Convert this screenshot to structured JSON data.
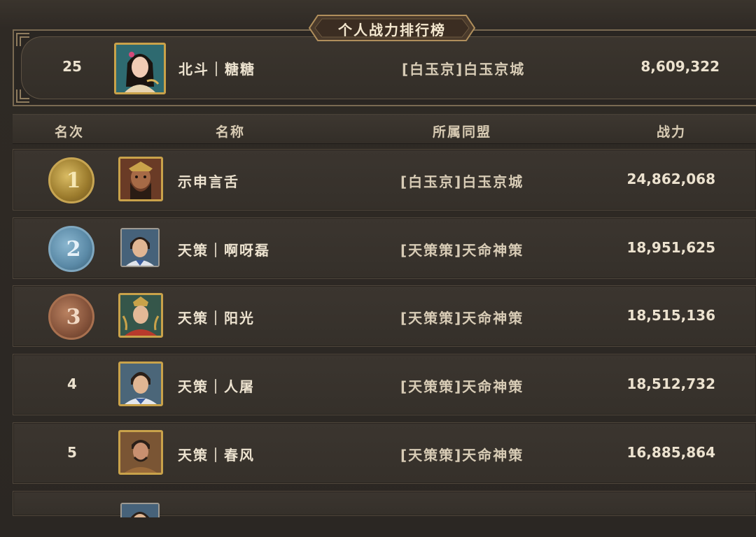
{
  "title": "个人战力排行榜",
  "my_rank": {
    "rank": "25",
    "name": "北斗｜糖糖",
    "alliance": "[白玉京]白玉京城",
    "power": "8,609,322",
    "avatar_icon": "female-hero-portrait"
  },
  "columns": {
    "rank": "名次",
    "name": "名称",
    "alliance": "所属同盟",
    "power": "战力"
  },
  "rows": [
    {
      "rank": "1",
      "name": "示申言舌",
      "alliance": "[白玉京]白玉京城",
      "power": "24,862,068",
      "medal": "gold"
    },
    {
      "rank": "2",
      "name": "天策｜啊呀磊",
      "alliance": "[天策策]天命神策",
      "power": "18,951,625",
      "medal": "silver"
    },
    {
      "rank": "3",
      "name": "天策｜阳光",
      "alliance": "[天策策]天命神策",
      "power": "18,515,136",
      "medal": "bronze"
    },
    {
      "rank": "4",
      "name": "天策｜人屠",
      "alliance": "[天策策]天命神策",
      "power": "18,512,732",
      "medal": ""
    },
    {
      "rank": "5",
      "name": "天策｜春风",
      "alliance": "[天策策]天命神策",
      "power": "16,885,864",
      "medal": ""
    }
  ],
  "colors": {
    "gold_medal": "#b8953e",
    "silver_medal": "#5e8fae",
    "bronze_medal": "#8c5a3c",
    "frame_gold": "#c9a24a"
  }
}
